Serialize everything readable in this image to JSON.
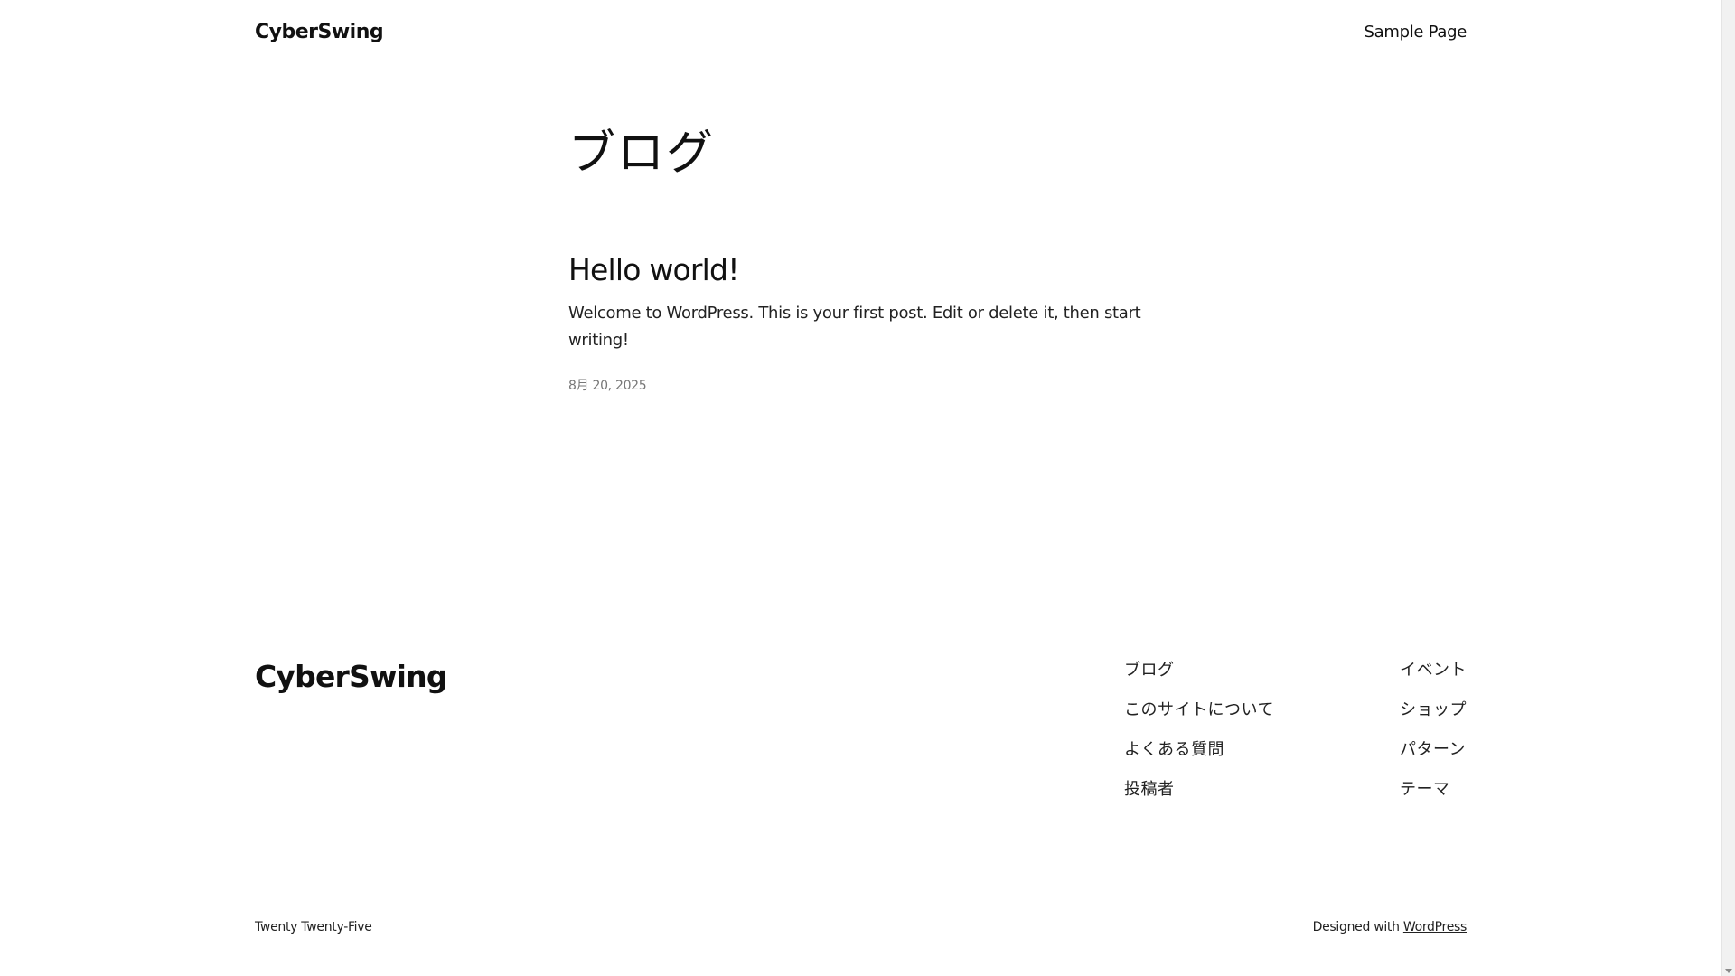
{
  "header": {
    "site_title": "CyberSwing",
    "nav": [
      {
        "label": "Sample Page"
      }
    ]
  },
  "main": {
    "page_title": "ブログ",
    "posts": [
      {
        "title": "Hello world!",
        "excerpt": "Welcome to WordPress. This is your first post. Edit or delete it, then start writing!",
        "date": "8月 20, 2025"
      }
    ]
  },
  "footer": {
    "site_title": "CyberSwing",
    "col1": [
      {
        "label": "ブログ"
      },
      {
        "label": "このサイトについて"
      },
      {
        "label": "よくある質問"
      },
      {
        "label": "投稿者"
      }
    ],
    "col2": [
      {
        "label": "イベント"
      },
      {
        "label": "ショップ"
      },
      {
        "label": "パターン"
      },
      {
        "label": "テーマ"
      }
    ],
    "theme_name": "Twenty Twenty-Five",
    "credit_prefix": "Designed with",
    "credit_link": "WordPress"
  }
}
